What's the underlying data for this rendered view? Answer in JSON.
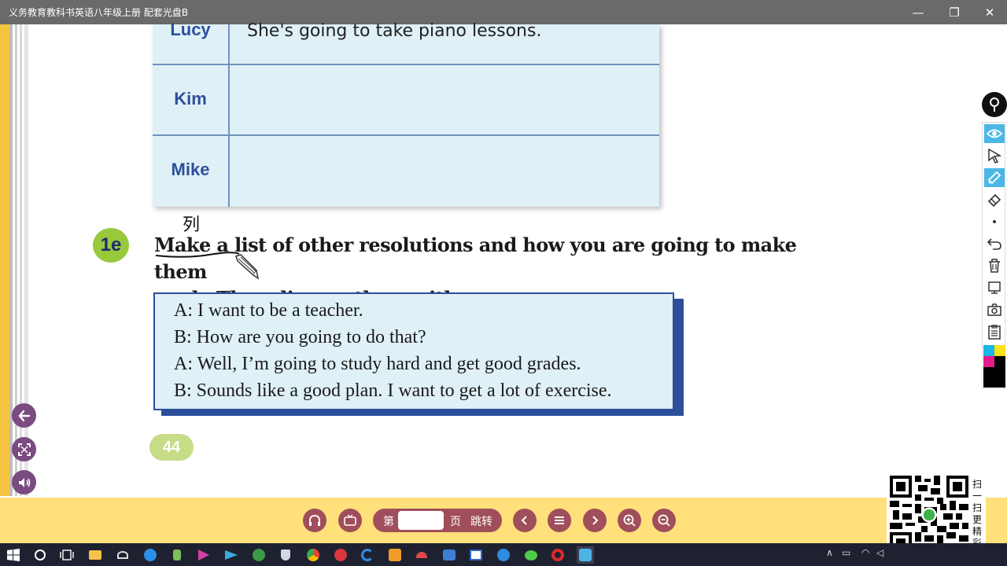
{
  "window": {
    "title": "义务教育教科书英语八年级上册 配套光盘B",
    "minimize_icon": "—",
    "restore_icon": "❐",
    "close_icon": "✕"
  },
  "table": {
    "rows": [
      {
        "name": "Lucy",
        "text": "She's going to take piano lessons."
      },
      {
        "name": "Kim",
        "text": ""
      },
      {
        "name": "Mike",
        "text": ""
      }
    ]
  },
  "section": {
    "badge": "1e",
    "instruction_line1": "Make a list of other resolutions and how you are going to make them",
    "instruction_line2": "work. Then discuss them with your group.",
    "handwritten_note": "列"
  },
  "dialog": {
    "lines": [
      "A: I want to be a teacher.",
      "B: How are you going to do that?",
      "A: Well, I’m going to study hard and get good grades.",
      "B: Sounds like a good plan. I want to get a lot of exercise."
    ]
  },
  "page_number": "44",
  "bottom": {
    "page_prefix": "第",
    "page_suffix": "页",
    "jump_label": "跳转",
    "page_input_value": ""
  },
  "qr": {
    "text": "扫一扫更精彩"
  },
  "colors": {
    "accent_blue": "#2d4f9b",
    "badge_green": "#98c93c",
    "bottom_bar": "#ffe07a",
    "button_maroon": "#a04e5b"
  }
}
